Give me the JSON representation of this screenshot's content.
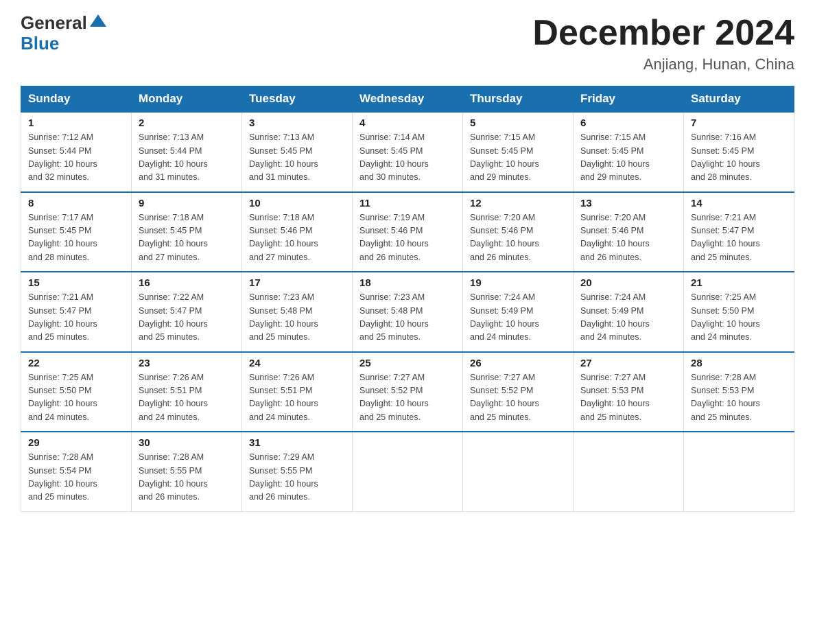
{
  "header": {
    "logo_general": "General",
    "logo_blue": "Blue",
    "month_title": "December 2024",
    "location": "Anjiang, Hunan, China"
  },
  "days_of_week": [
    "Sunday",
    "Monday",
    "Tuesday",
    "Wednesday",
    "Thursday",
    "Friday",
    "Saturday"
  ],
  "weeks": [
    [
      {
        "day": "1",
        "sunrise": "7:12 AM",
        "sunset": "5:44 PM",
        "daylight": "10 hours and 32 minutes."
      },
      {
        "day": "2",
        "sunrise": "7:13 AM",
        "sunset": "5:44 PM",
        "daylight": "10 hours and 31 minutes."
      },
      {
        "day": "3",
        "sunrise": "7:13 AM",
        "sunset": "5:45 PM",
        "daylight": "10 hours and 31 minutes."
      },
      {
        "day": "4",
        "sunrise": "7:14 AM",
        "sunset": "5:45 PM",
        "daylight": "10 hours and 30 minutes."
      },
      {
        "day": "5",
        "sunrise": "7:15 AM",
        "sunset": "5:45 PM",
        "daylight": "10 hours and 29 minutes."
      },
      {
        "day": "6",
        "sunrise": "7:15 AM",
        "sunset": "5:45 PM",
        "daylight": "10 hours and 29 minutes."
      },
      {
        "day": "7",
        "sunrise": "7:16 AM",
        "sunset": "5:45 PM",
        "daylight": "10 hours and 28 minutes."
      }
    ],
    [
      {
        "day": "8",
        "sunrise": "7:17 AM",
        "sunset": "5:45 PM",
        "daylight": "10 hours and 28 minutes."
      },
      {
        "day": "9",
        "sunrise": "7:18 AM",
        "sunset": "5:45 PM",
        "daylight": "10 hours and 27 minutes."
      },
      {
        "day": "10",
        "sunrise": "7:18 AM",
        "sunset": "5:46 PM",
        "daylight": "10 hours and 27 minutes."
      },
      {
        "day": "11",
        "sunrise": "7:19 AM",
        "sunset": "5:46 PM",
        "daylight": "10 hours and 26 minutes."
      },
      {
        "day": "12",
        "sunrise": "7:20 AM",
        "sunset": "5:46 PM",
        "daylight": "10 hours and 26 minutes."
      },
      {
        "day": "13",
        "sunrise": "7:20 AM",
        "sunset": "5:46 PM",
        "daylight": "10 hours and 26 minutes."
      },
      {
        "day": "14",
        "sunrise": "7:21 AM",
        "sunset": "5:47 PM",
        "daylight": "10 hours and 25 minutes."
      }
    ],
    [
      {
        "day": "15",
        "sunrise": "7:21 AM",
        "sunset": "5:47 PM",
        "daylight": "10 hours and 25 minutes."
      },
      {
        "day": "16",
        "sunrise": "7:22 AM",
        "sunset": "5:47 PM",
        "daylight": "10 hours and 25 minutes."
      },
      {
        "day": "17",
        "sunrise": "7:23 AM",
        "sunset": "5:48 PM",
        "daylight": "10 hours and 25 minutes."
      },
      {
        "day": "18",
        "sunrise": "7:23 AM",
        "sunset": "5:48 PM",
        "daylight": "10 hours and 25 minutes."
      },
      {
        "day": "19",
        "sunrise": "7:24 AM",
        "sunset": "5:49 PM",
        "daylight": "10 hours and 24 minutes."
      },
      {
        "day": "20",
        "sunrise": "7:24 AM",
        "sunset": "5:49 PM",
        "daylight": "10 hours and 24 minutes."
      },
      {
        "day": "21",
        "sunrise": "7:25 AM",
        "sunset": "5:50 PM",
        "daylight": "10 hours and 24 minutes."
      }
    ],
    [
      {
        "day": "22",
        "sunrise": "7:25 AM",
        "sunset": "5:50 PM",
        "daylight": "10 hours and 24 minutes."
      },
      {
        "day": "23",
        "sunrise": "7:26 AM",
        "sunset": "5:51 PM",
        "daylight": "10 hours and 24 minutes."
      },
      {
        "day": "24",
        "sunrise": "7:26 AM",
        "sunset": "5:51 PM",
        "daylight": "10 hours and 24 minutes."
      },
      {
        "day": "25",
        "sunrise": "7:27 AM",
        "sunset": "5:52 PM",
        "daylight": "10 hours and 25 minutes."
      },
      {
        "day": "26",
        "sunrise": "7:27 AM",
        "sunset": "5:52 PM",
        "daylight": "10 hours and 25 minutes."
      },
      {
        "day": "27",
        "sunrise": "7:27 AM",
        "sunset": "5:53 PM",
        "daylight": "10 hours and 25 minutes."
      },
      {
        "day": "28",
        "sunrise": "7:28 AM",
        "sunset": "5:53 PM",
        "daylight": "10 hours and 25 minutes."
      }
    ],
    [
      {
        "day": "29",
        "sunrise": "7:28 AM",
        "sunset": "5:54 PM",
        "daylight": "10 hours and 25 minutes."
      },
      {
        "day": "30",
        "sunrise": "7:28 AM",
        "sunset": "5:55 PM",
        "daylight": "10 hours and 26 minutes."
      },
      {
        "day": "31",
        "sunrise": "7:29 AM",
        "sunset": "5:55 PM",
        "daylight": "10 hours and 26 minutes."
      },
      null,
      null,
      null,
      null
    ]
  ],
  "labels": {
    "sunrise": "Sunrise:",
    "sunset": "Sunset:",
    "daylight": "Daylight:"
  }
}
